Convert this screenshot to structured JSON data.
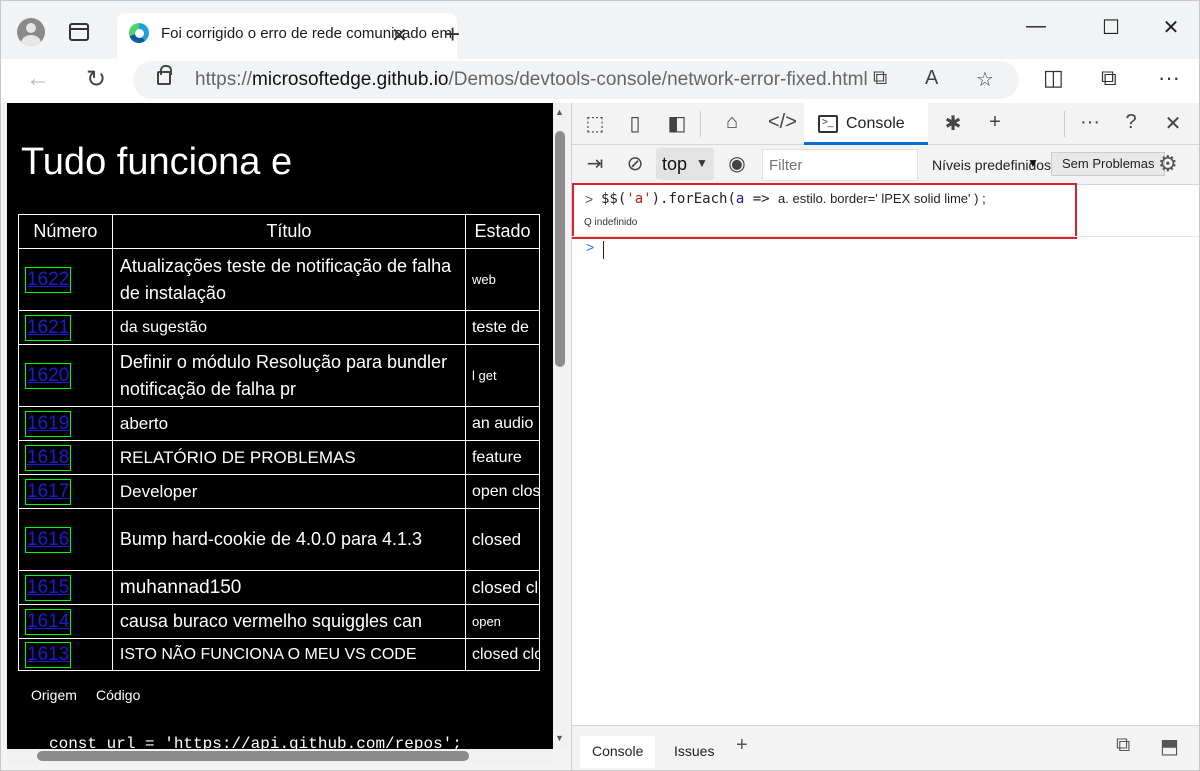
{
  "browser": {
    "tab_title": "Foi corrigido o erro de rede comunicado em",
    "url_prefix": "https://",
    "url_host": "microsoftedge.github.io",
    "url_path": "/Demos/devtools-console/network-error-fixed.html"
  },
  "page": {
    "heading": "Tudo funciona e",
    "table": {
      "headers": [
        "Número",
        "Título",
        "Estado"
      ],
      "rows": [
        {
          "number": "1622",
          "title": "Atualizações teste de notificação de falha de instalação",
          "state": "web"
        },
        {
          "number": "1621",
          "title": "da sugestão",
          "state": "teste de"
        },
        {
          "number": "1620",
          "title": "Definir o módulo Resolução para bundler notificação de falha pr",
          "state": "l get"
        },
        {
          "number": "1619",
          "title": "aberto",
          "state": "an audio"
        },
        {
          "number": "1618",
          "title": "RELATÓRIO DE PROBLEMAS",
          "state": "feature"
        },
        {
          "number": "1617",
          "title": "Developer",
          "state": "open closed"
        },
        {
          "number": "1616",
          "title": "Bump hard-cookie de 4.0.0 para 4.1.3",
          "state": "closed"
        },
        {
          "number": "1615",
          "title": "muhannad150",
          "state": "closed closed"
        },
        {
          "number": "1614",
          "title": "causa buraco vermelho squiggles can",
          "state": "open"
        },
        {
          "number": "1613",
          "title": "ISTO NÃO FUNCIONA   O MEU VS CODE",
          "state": "closed closed"
        }
      ]
    },
    "footer_links": [
      "Origem",
      "Código"
    ],
    "code_line": "const url = 'https://api.github.com/repos';"
  },
  "devtools": {
    "active_tab": "Console",
    "context": "top",
    "filter_placeholder": "Filter",
    "levels": "Níveis predefinidos",
    "issues_button": "Sem Problemas",
    "console_code": {
      "part1": "$$(",
      "part2": "'a'",
      "part3": ").forEach(",
      "part4": "a",
      "part5": " => ",
      "part6": " a. estilo. border=' lPEX solid lime' ) ;"
    },
    "console_result": "Q indefinido",
    "drawer_tabs": [
      "Console",
      "Issues"
    ]
  },
  "colors": {
    "highlight_border": "#d9232d",
    "link_outline": "lime",
    "active_tab_underline": "#0b6bd3"
  }
}
